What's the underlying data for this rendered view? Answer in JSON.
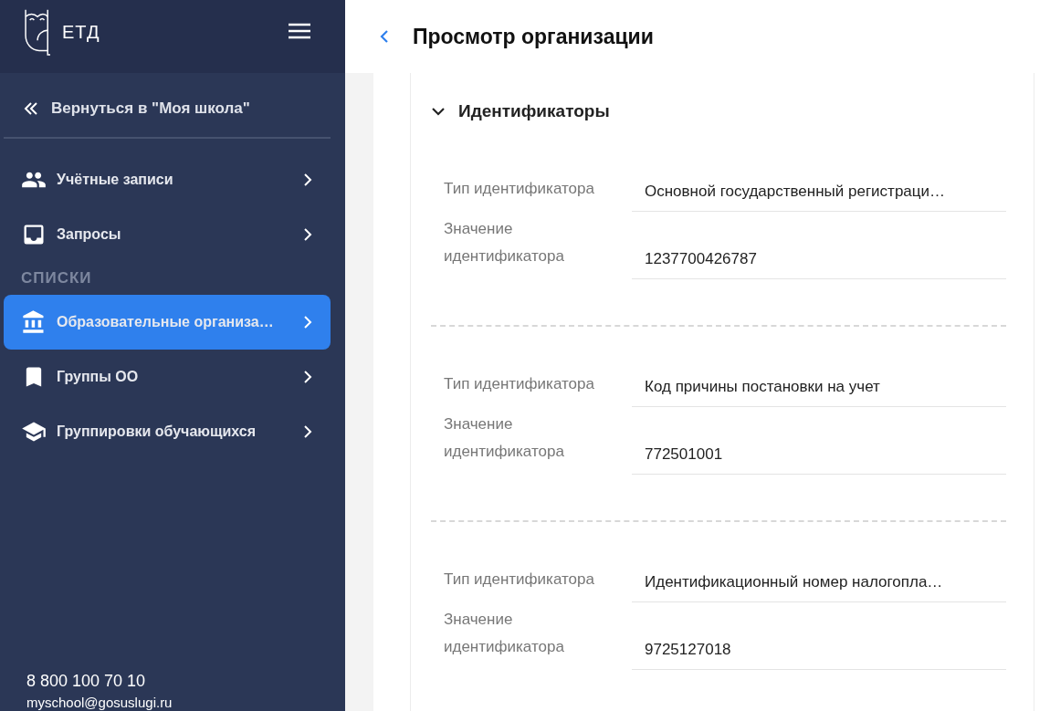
{
  "sidebar": {
    "logo_text": "ЕТД",
    "back_link": "Вернуться в \"Моя школа\"",
    "items": [
      {
        "label": "Учётные записи",
        "selected": false
      },
      {
        "label": "Запросы",
        "selected": false
      }
    ],
    "section_title": "СПИСКИ",
    "list_items": [
      {
        "label": "Образовательные организа…",
        "selected": true
      },
      {
        "label": "Группы ОО",
        "selected": false
      },
      {
        "label": "Группировки обучающихся",
        "selected": false
      }
    ],
    "phone": "8 800 100 70 10",
    "email": "myschool@gosuslugi.ru"
  },
  "header": {
    "title": "Просмотр организации"
  },
  "section": {
    "title": "Идентификаторы",
    "expanded": true,
    "groups": [
      {
        "fields": [
          {
            "label": "Тип идентификатора",
            "value": "Основной государственный регистраци…"
          },
          {
            "label": "Значение идентификатора",
            "value": "1237700426787"
          }
        ]
      },
      {
        "fields": [
          {
            "label": "Тип идентификатора",
            "value": "Код причины постановки на учет"
          },
          {
            "label": "Значение идентификатора",
            "value": "772501001"
          }
        ]
      },
      {
        "fields": [
          {
            "label": "Тип идентификатора",
            "value": "Идентификационный номер налогопла…"
          },
          {
            "label": "Значение идентификатора",
            "value": "9725127018"
          }
        ]
      }
    ]
  }
}
